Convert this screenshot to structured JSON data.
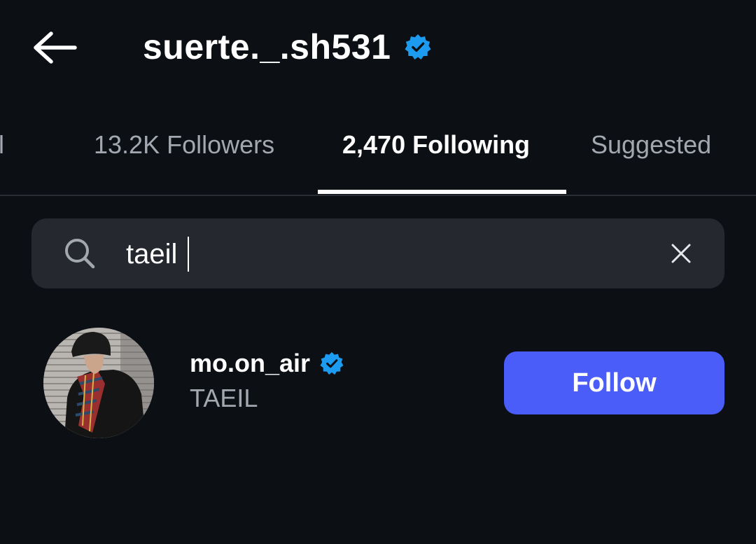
{
  "header": {
    "title": "suerte._.sh531",
    "back_icon": "arrow-left-icon",
    "verified_icon": "verified-badge-icon",
    "verified_color": "#1d9bf0"
  },
  "tabs": [
    {
      "label": "Mutual",
      "visible_label": "tual",
      "active": false
    },
    {
      "label": "13.2K Followers",
      "active": false
    },
    {
      "label": "2,470 Following",
      "active": true
    },
    {
      "label": "Suggested",
      "active": false
    }
  ],
  "search": {
    "value": "taeil",
    "search_icon": "search-icon",
    "clear_icon": "close-icon"
  },
  "results": [
    {
      "username": "mo.on_air",
      "full_name": "TAEIL",
      "verified": true,
      "follow_label": "Follow",
      "avatar_icon": "avatar-photo"
    }
  ],
  "colors": {
    "background": "#0c0f14",
    "search_bg": "#25282e",
    "accent": "#4a5df9",
    "muted_text": "#a3a7b0"
  }
}
